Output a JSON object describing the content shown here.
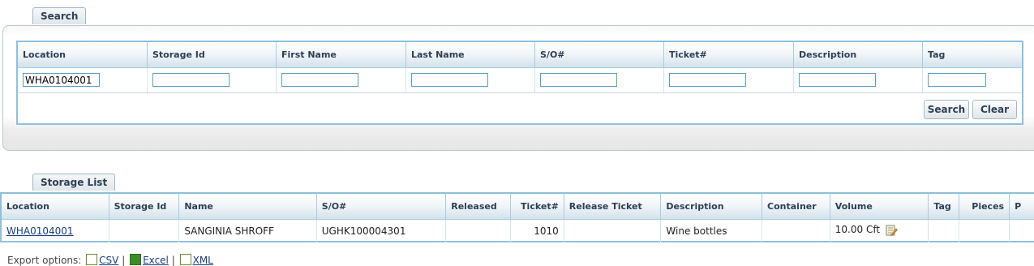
{
  "search_tab": "Search",
  "search": {
    "columns": [
      "Location",
      "Storage Id",
      "First Name",
      "Last Name",
      "S/O#",
      "Ticket#",
      "Description",
      "Tag"
    ],
    "values": [
      "WHA0104001",
      "",
      "",
      "",
      "",
      "",
      "",
      ""
    ],
    "search_label": "Search",
    "clear_label": "Clear"
  },
  "list_tab": "Storage List",
  "list": {
    "columns": [
      "Location",
      "Storage Id",
      "Name",
      "S/O#",
      "Released",
      "Ticket#",
      "Release Ticket",
      "Description",
      "Container",
      "Volume",
      "Tag",
      "Pieces",
      "P"
    ],
    "row": {
      "location": "WHA0104001",
      "storage_id": "",
      "name": "SANGINIA SHROFF",
      "so": "UGHK100004301",
      "released": "",
      "ticket": "1010",
      "release_ticket": "",
      "description": "Wine bottles",
      "container": "",
      "volume": "10.00 Cft",
      "tag": "",
      "pieces": "",
      "p": ""
    }
  },
  "export": {
    "label": "Export options:",
    "csv": "CSV",
    "excel": "Excel",
    "xml": "XML",
    "sep": "|"
  },
  "icons": {
    "edit": "edit-note-icon",
    "csv": "csv-file-icon",
    "excel": "excel-file-icon",
    "xml": "xml-file-icon"
  }
}
